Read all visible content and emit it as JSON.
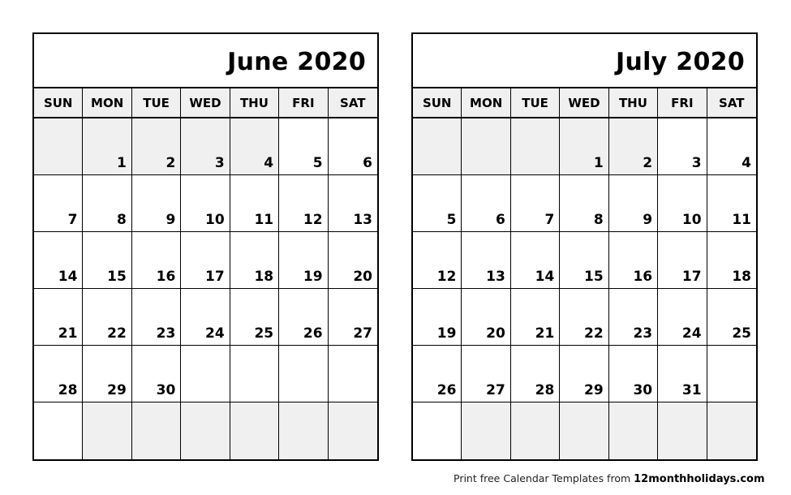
{
  "weekdays": [
    "SUN",
    "MON",
    "TUE",
    "WED",
    "THU",
    "FRI",
    "SAT"
  ],
  "calendars": [
    {
      "title": "June 2020",
      "rows": [
        [
          "",
          "1",
          "2",
          "3",
          "4",
          "5",
          "6"
        ],
        [
          "7",
          "8",
          "9",
          "10",
          "11",
          "12",
          "13"
        ],
        [
          "14",
          "15",
          "16",
          "17",
          "18",
          "19",
          "20"
        ],
        [
          "21",
          "22",
          "23",
          "24",
          "25",
          "26",
          "27"
        ],
        [
          "28",
          "29",
          "30",
          "",
          "",
          "",
          ""
        ],
        [
          "",
          "",
          "",
          "",
          "",
          "",
          ""
        ]
      ],
      "shaded": [
        [
          true,
          true,
          true,
          true,
          true,
          false,
          false
        ],
        [
          false,
          false,
          false,
          false,
          false,
          false,
          false
        ],
        [
          false,
          false,
          false,
          false,
          false,
          false,
          false
        ],
        [
          false,
          false,
          false,
          false,
          false,
          false,
          false
        ],
        [
          false,
          false,
          false,
          false,
          false,
          false,
          false
        ],
        [
          false,
          true,
          true,
          true,
          true,
          true,
          true
        ]
      ]
    },
    {
      "title": "July 2020",
      "rows": [
        [
          "",
          "",
          "",
          "1",
          "2",
          "3",
          "4"
        ],
        [
          "5",
          "6",
          "7",
          "8",
          "9",
          "10",
          "11"
        ],
        [
          "12",
          "13",
          "14",
          "15",
          "16",
          "17",
          "18"
        ],
        [
          "19",
          "20",
          "21",
          "22",
          "23",
          "24",
          "25"
        ],
        [
          "26",
          "27",
          "28",
          "29",
          "30",
          "31",
          ""
        ],
        [
          "",
          "",
          "",
          "",
          "",
          "",
          ""
        ]
      ],
      "shaded": [
        [
          true,
          true,
          true,
          true,
          true,
          false,
          false
        ],
        [
          false,
          false,
          false,
          false,
          false,
          false,
          false
        ],
        [
          false,
          false,
          false,
          false,
          false,
          false,
          false
        ],
        [
          false,
          false,
          false,
          false,
          false,
          false,
          false
        ],
        [
          false,
          false,
          false,
          false,
          false,
          false,
          false
        ],
        [
          false,
          true,
          true,
          true,
          true,
          true,
          true
        ]
      ]
    }
  ],
  "footer": {
    "prefix": "Print free Calendar Templates from ",
    "site": "12monthholidays.com"
  },
  "colors": {
    "shade": "#f0f0f0",
    "border": "#000000"
  }
}
